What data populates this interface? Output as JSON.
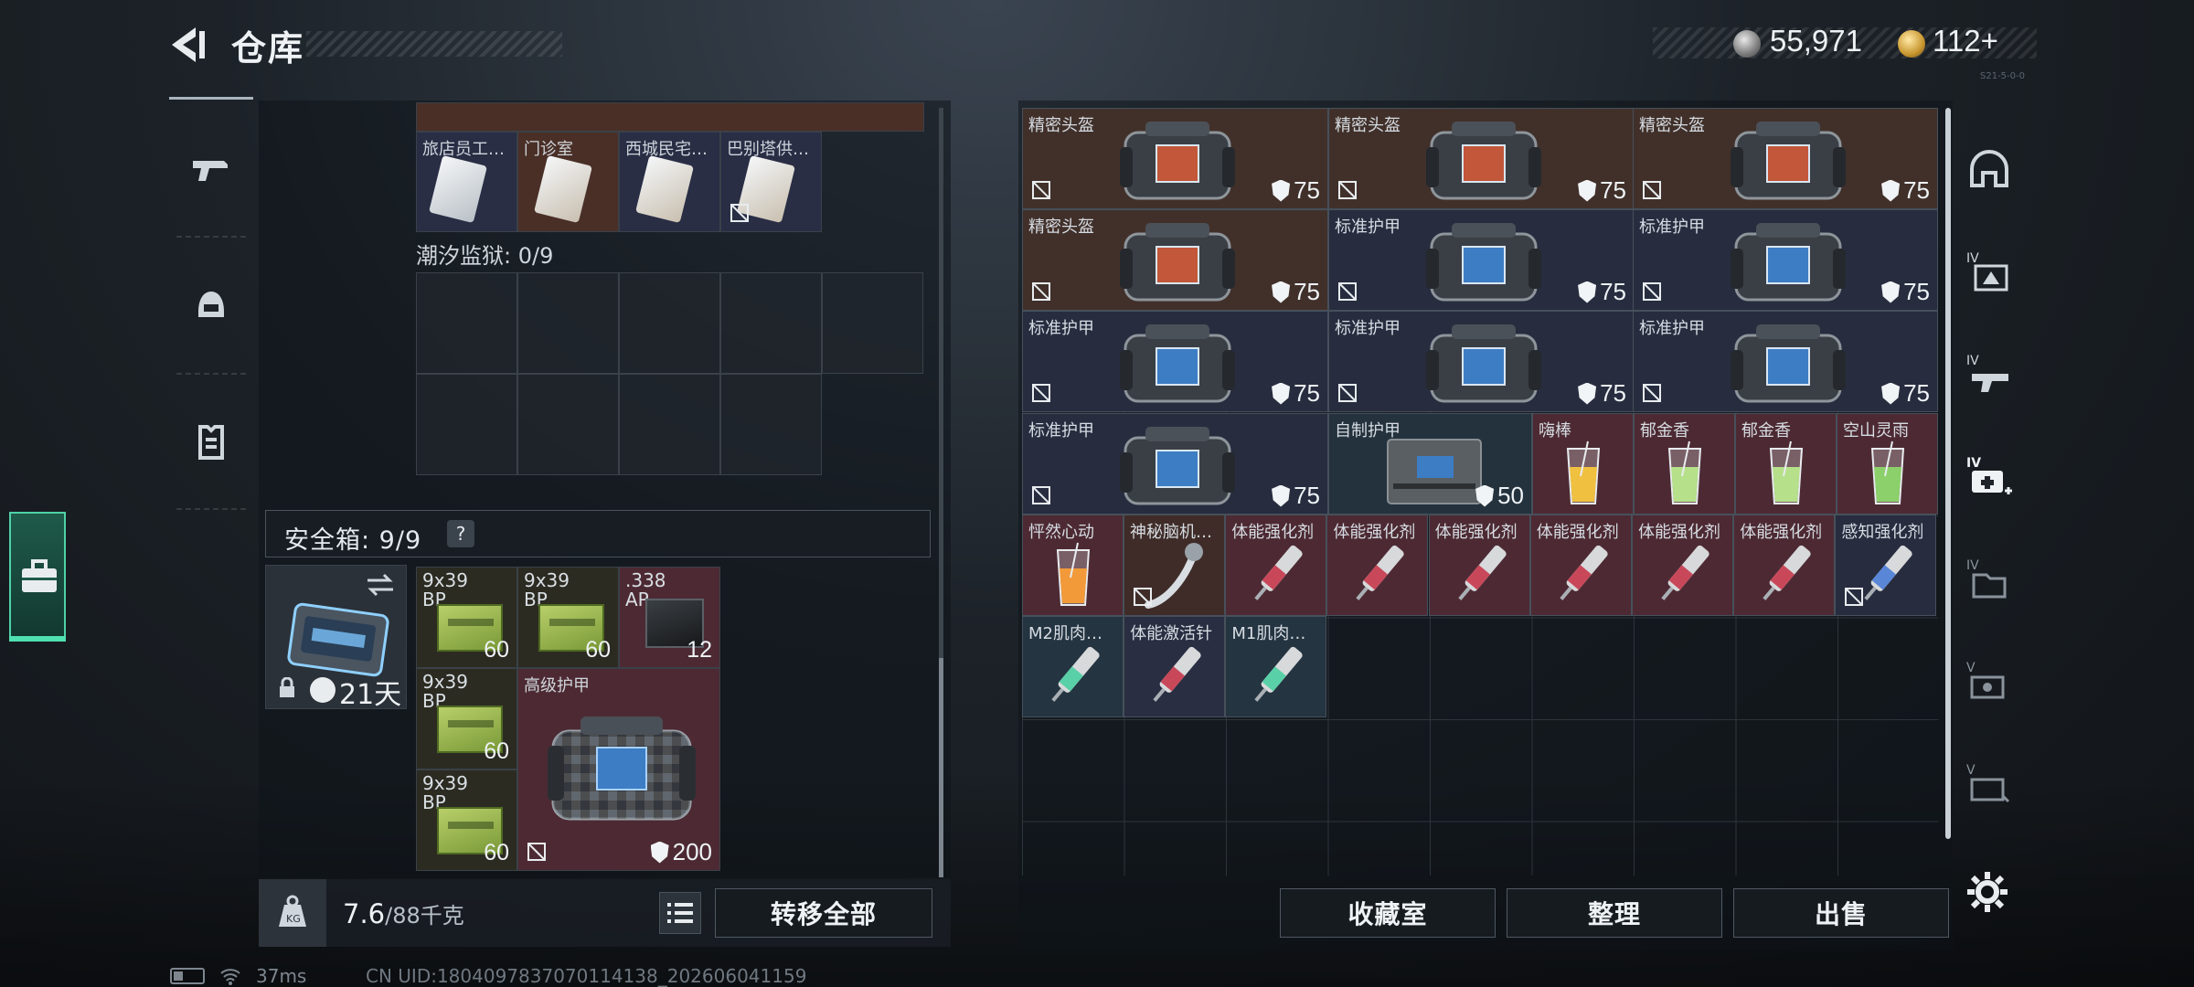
{
  "header": {
    "title": "仓库",
    "currency_silver": "55,971",
    "currency_gold": "112+",
    "small_tag": "S21-5-0-0"
  },
  "left_nav": {
    "items": [
      "weapon",
      "helmet",
      "armor",
      "rig",
      "safebox"
    ]
  },
  "stash_top": {
    "labels": [
      "旅店员工…",
      "门诊室",
      "西城民宅…",
      "巴别塔供…"
    ],
    "section_title": "潮汐监狱: 0/9"
  },
  "safe_box": {
    "label": "安全箱: 9/9",
    "help": "?",
    "case_days": "21天",
    "items": [
      {
        "caliber": "9x39\nBP",
        "count": "60"
      },
      {
        "caliber": "9x39\nBP",
        "count": "60"
      },
      {
        "caliber": ".338\nAP",
        "count": "12"
      },
      {
        "caliber": "9x39\nBP",
        "count": "60"
      },
      {
        "caliber": "9x39\nBP",
        "count": "60"
      }
    ],
    "armor": {
      "name": "高级护甲",
      "value": "200"
    }
  },
  "left_bar": {
    "weight": "7.6",
    "capacity": "/88千克",
    "transfer_all": "转移全部"
  },
  "right_grid": {
    "big_items": [
      {
        "name": "精密头盔",
        "value": "75",
        "kind": "helmet"
      },
      {
        "name": "精密头盔",
        "value": "75",
        "kind": "helmet"
      },
      {
        "name": "精密头盔",
        "value": "75",
        "kind": "helmet"
      },
      {
        "name": "精密头盔",
        "value": "75",
        "kind": "helmet"
      },
      {
        "name": "标准护甲",
        "value": "75",
        "kind": "armor"
      },
      {
        "name": "标准护甲",
        "value": "75",
        "kind": "armor"
      },
      {
        "name": "标准护甲",
        "value": "75",
        "kind": "armor"
      },
      {
        "name": "标准护甲",
        "value": "75",
        "kind": "armor"
      },
      {
        "name": "标准护甲",
        "value": "75",
        "kind": "armor"
      },
      {
        "name": "标准护甲",
        "value": "75",
        "kind": "armor"
      }
    ],
    "homemade_armor": {
      "name": "自制护甲",
      "value": "50"
    },
    "drinks": [
      "嗨棒",
      "郁金香",
      "郁金香",
      "空山灵雨",
      "怦然心动"
    ],
    "row5": [
      "神秘脑机…",
      "体能强化剂",
      "体能强化剂",
      "体能强化剂",
      "体能强化剂",
      "体能强化剂",
      "体能强化剂",
      "感知强化剂"
    ],
    "row6": [
      "M2肌肉…",
      "体能激活针",
      "M1肌肉…"
    ]
  },
  "right_buttons": {
    "collection": "收藏室",
    "organize": "整理",
    "sell": "出售"
  },
  "status": {
    "ping": "37ms",
    "uid": "CN UID:1804097837070114138_202606041159"
  },
  "colors": {
    "accent": "#4fd1a6",
    "brown": "#4a2f27",
    "navy": "#292e45",
    "red": "#4d2a33"
  }
}
